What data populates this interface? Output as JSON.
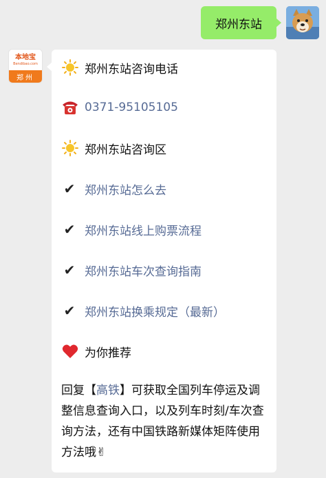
{
  "outgoing": {
    "text": "郑州东站"
  },
  "bot_avatar": {
    "logo_text": "本地宝",
    "logo_sub": "Bendibao.com",
    "city": "郑州"
  },
  "incoming": {
    "hotline_title": "郑州东站咨询电话",
    "phone": "0371-95105105",
    "section_title": "郑州东站咨询区",
    "links": [
      "郑州东站怎么去",
      "郑州东站线上购票流程",
      "郑州东站车次查询指南",
      "郑州东站换乘规定（最新）"
    ],
    "recommend_title": "为你推荐",
    "reply_prefix": "回复【",
    "reply_keyword": "高铁",
    "reply_suffix": "】可获取全国列车停运及调整信息查询入口，以及列车时刻/车次查询方法，还有中国铁路新媒体矩阵使用方法哦✌"
  },
  "icons": {
    "sun": "sun-icon",
    "telephone": "telephone-icon",
    "check": "check-mark-icon",
    "heart": "heart-icon"
  },
  "colors": {
    "background": "#ededed",
    "outgoing_bubble": "#95ec69",
    "incoming_bubble": "#ffffff",
    "link": "#576b95",
    "brand_orange": "#f07a1c"
  }
}
